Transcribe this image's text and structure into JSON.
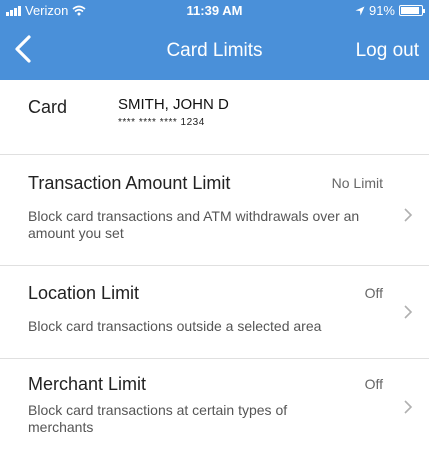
{
  "status_bar": {
    "carrier": "Verizon",
    "time": "11:39 AM",
    "battery_percent": "91%",
    "battery_level": 0.91
  },
  "nav": {
    "title": "Card Limits",
    "logout_label": "Log out",
    "back_icon": "chevron-left-icon"
  },
  "card": {
    "label": "Card",
    "name": "SMITH, JOHN D",
    "number": "**** **** **** 1234"
  },
  "limits": [
    {
      "title": "Transaction Amount Limit",
      "status": "No Limit",
      "description": "Block card transactions and ATM withdrawals over an amount you set"
    },
    {
      "title": "Location Limit",
      "status": "Off",
      "description": "Block card transactions outside a selected area"
    },
    {
      "title": "Merchant Limit",
      "status": "Off",
      "description": "Block card transactions at certain types of merchants"
    }
  ],
  "colors": {
    "header": "#4a90d9",
    "text": "#222222",
    "muted": "#666666",
    "divider": "#e0e0e0"
  }
}
